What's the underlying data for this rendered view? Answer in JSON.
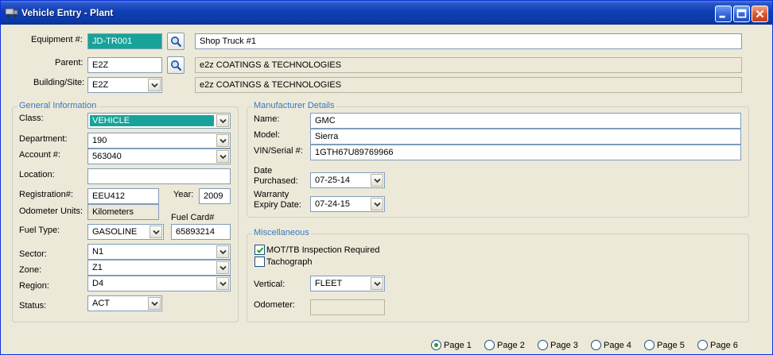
{
  "window": {
    "title": "Vehicle Entry - Plant"
  },
  "header": {
    "equipment_label": "Equipment #:",
    "equipment_value": "JD-TR001",
    "equipment_desc": "Shop Truck #1",
    "parent_label": "Parent:",
    "parent_value": "E2Z",
    "parent_desc": "e2z COATINGS & TECHNOLOGIES",
    "building_label": "Building/Site:",
    "building_value": "E2Z",
    "building_desc": "e2z COATINGS & TECHNOLOGIES"
  },
  "general": {
    "title": "General Information",
    "class_label": "Class:",
    "class_value": "VEHICLE",
    "department_label": "Department:",
    "department_value": "190",
    "account_label": "Account #:",
    "account_value": "563040",
    "location_label": "Location:",
    "location_value": "",
    "registration_label": "Registration#:",
    "registration_value": "EEU412",
    "year_label": "Year:",
    "year_value": "2009",
    "odometer_units_label": "Odometer Units:",
    "odometer_units_value": "Kilometers",
    "fuel_card_label": "Fuel Card#",
    "fuel_type_label": "Fuel Type:",
    "fuel_type_value": "GASOLINE",
    "fuel_card_value": "65893214",
    "sector_label": "Sector:",
    "sector_value": "N1",
    "zone_label": "Zone:",
    "zone_value": "Z1",
    "region_label": "Region:",
    "region_value": "D4",
    "status_label": "Status:",
    "status_value": "ACT"
  },
  "manufacturer": {
    "title": "Manufacturer Details",
    "name_label": "Name:",
    "name_value": "GMC",
    "model_label": "Model:",
    "model_value": "Sierra",
    "vin_label": "VIN/Serial #:",
    "vin_value": "1GTH67U89769966",
    "date_label_1": "Date",
    "date_label_2": "Purchased:",
    "date_purchased": "07-25-14",
    "warranty_label_1": "Warranty",
    "warranty_label_2": "Expiry Date:",
    "warranty_expiry": "07-24-15"
  },
  "misc": {
    "title": "Miscellaneous",
    "mot_label": "MOT/TB Inspection Required",
    "tacho_label": "Tachograph",
    "vertical_label": "Vertical:",
    "vertical_value": "FLEET",
    "odometer_label": "Odometer:",
    "odometer_value": ""
  },
  "pages": {
    "p1": "Page 1",
    "p2": "Page 2",
    "p3": "Page 3",
    "p4": "Page 4",
    "p5": "Page 5",
    "p6": "Page 6"
  },
  "colors": {
    "title_bar": "#0c3aa8",
    "group_title": "#3a77c4",
    "highlight": "#17a39a"
  },
  "icons": {
    "app": "truck-icon",
    "search": "magnifier-icon",
    "dropdown": "chevron-down-icon"
  }
}
